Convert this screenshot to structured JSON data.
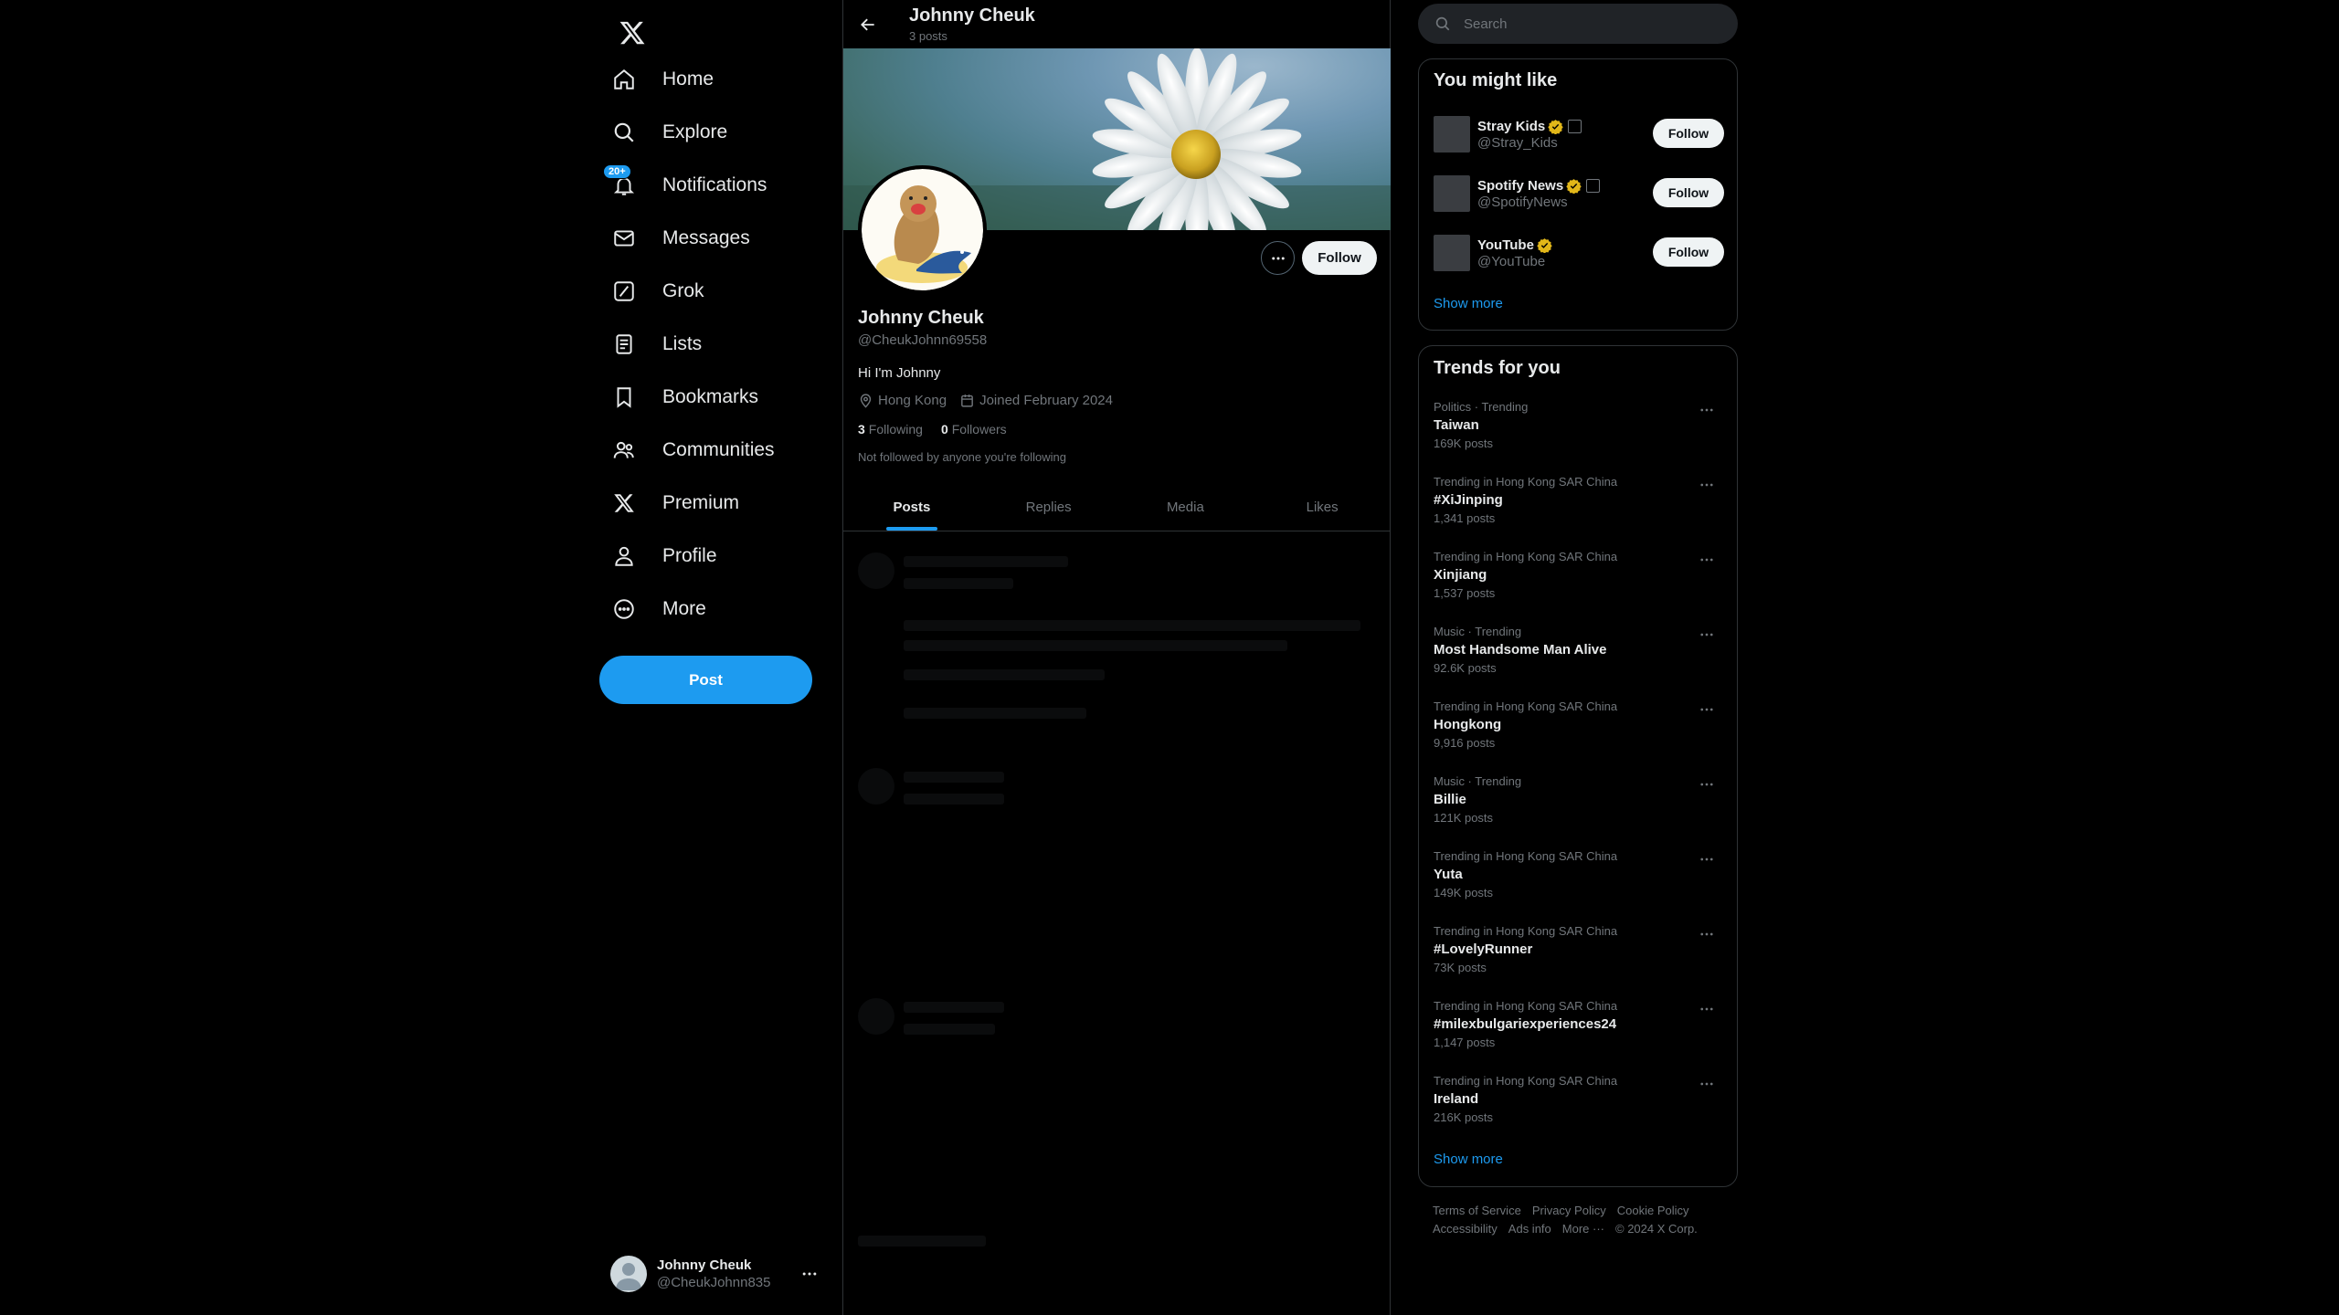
{
  "nav": {
    "items": [
      {
        "label": "Home",
        "icon": "home-icon"
      },
      {
        "label": "Explore",
        "icon": "search-icon"
      },
      {
        "label": "Notifications",
        "icon": "bell-icon",
        "badge": "20+"
      },
      {
        "label": "Messages",
        "icon": "envelope-icon"
      },
      {
        "label": "Grok",
        "icon": "grok-icon"
      },
      {
        "label": "Lists",
        "icon": "list-icon"
      },
      {
        "label": "Bookmarks",
        "icon": "bookmark-icon"
      },
      {
        "label": "Communities",
        "icon": "people-icon"
      },
      {
        "label": "Premium",
        "icon": "x-logo-icon"
      },
      {
        "label": "Profile",
        "icon": "person-icon"
      },
      {
        "label": "More",
        "icon": "more-circle-icon"
      }
    ],
    "post_label": "Post",
    "account": {
      "name": "Johnny Cheuk",
      "handle": "@CheukJohnn835"
    }
  },
  "header": {
    "name": "Johnny Cheuk",
    "post_count": "3 posts"
  },
  "profile": {
    "follow_label": "Follow",
    "name": "Johnny Cheuk",
    "handle": "@CheukJohnn69558",
    "bio": "Hi I'm Johnny",
    "location": "Hong Kong",
    "joined": "Joined February 2024",
    "following_count": "3",
    "following_label": "Following",
    "followers_count": "0",
    "followers_label": "Followers",
    "not_followed": "Not followed by anyone you're following"
  },
  "tabs": [
    "Posts",
    "Replies",
    "Media",
    "Likes"
  ],
  "search": {
    "placeholder": "Search"
  },
  "who_to_follow": {
    "title": "You might like",
    "users": [
      {
        "name": "Stray Kids",
        "handle": "@Stray_Kids",
        "follow_label": "Follow"
      },
      {
        "name": "Spotify News",
        "handle": "@SpotifyNews",
        "follow_label": "Follow"
      },
      {
        "name": "YouTube",
        "handle": "@YouTube",
        "follow_label": "Follow"
      }
    ],
    "show_more": "Show more"
  },
  "trends": {
    "title": "Trends for you",
    "items": [
      {
        "context": "Politics · Trending",
        "name": "Taiwan",
        "count": "169K posts"
      },
      {
        "context": "Trending in Hong Kong SAR China",
        "name": "#XiJinping",
        "count": "1,341 posts"
      },
      {
        "context": "Trending in Hong Kong SAR China",
        "name": "Xinjiang",
        "count": "1,537 posts"
      },
      {
        "context": "Music · Trending",
        "name": "Most Handsome Man Alive",
        "count": "92.6K posts"
      },
      {
        "context": "Trending in Hong Kong SAR China",
        "name": "Hongkong",
        "count": "9,916 posts"
      },
      {
        "context": "Music · Trending",
        "name": "Billie",
        "count": "121K posts"
      },
      {
        "context": "Trending in Hong Kong SAR China",
        "name": "Yuta",
        "count": "149K posts"
      },
      {
        "context": "Trending in Hong Kong SAR China",
        "name": "#LovelyRunner",
        "count": "73K posts"
      },
      {
        "context": "Trending in Hong Kong SAR China",
        "name": "#milexbulgariexperiences24",
        "count": "1,147 posts"
      },
      {
        "context": "Trending in Hong Kong SAR China",
        "name": "Ireland",
        "count": "216K posts"
      }
    ],
    "show_more": "Show more"
  },
  "footer": {
    "links": [
      "Terms of Service",
      "Privacy Policy",
      "Cookie Policy",
      "Accessibility",
      "Ads info",
      "More ···",
      "© 2024 X Corp."
    ]
  },
  "colors": {
    "accent": "#1d9bf0",
    "background": "#000000",
    "text": "#e7e9ea",
    "muted": "#71767b",
    "verified": "#e2b719"
  }
}
